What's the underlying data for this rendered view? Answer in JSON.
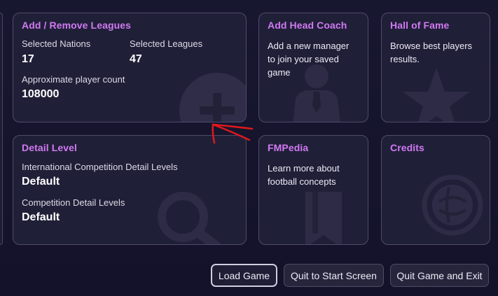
{
  "cards": {
    "leagues": {
      "title": "Add / Remove Leagues",
      "nations_label": "Selected Nations",
      "nations_value": "17",
      "leagues_label": "Selected Leagues",
      "leagues_value": "47",
      "players_label": "Approximate player count",
      "players_value": "108000",
      "icon": "plus-circle-icon"
    },
    "head_coach": {
      "title": "Add Head Coach",
      "description_lines": [
        "Add a new manager",
        "to join your saved",
        "game"
      ],
      "icon": "manager-silhouette-icon"
    },
    "hall_of_fame": {
      "title": "Hall of Fame",
      "description_lines": [
        "Browse best players",
        "results."
      ],
      "icon": "star-icon"
    },
    "detail_level": {
      "title": "Detail Level",
      "intl_label": "International Competition Detail Levels",
      "intl_value": "Default",
      "comp_label": "Competition Detail Levels",
      "comp_value": "Default",
      "icon": "magnifier-icon"
    },
    "fmpedia": {
      "title": "FMPedia",
      "description_lines": [
        "Learn more about",
        "football concepts"
      ],
      "icon": "book-icon"
    },
    "credits": {
      "title": "Credits",
      "icon": "football-icon"
    }
  },
  "buttons": {
    "load_game": "Load Game",
    "quit_start": "Quit to Start Screen",
    "quit_exit": "Quit Game and Exit"
  },
  "colors": {
    "background": "#15142a",
    "card": "#201f38",
    "card_border": "#4e4b6a",
    "title_accent": "#d07af2",
    "annotation": "#e0191c"
  }
}
